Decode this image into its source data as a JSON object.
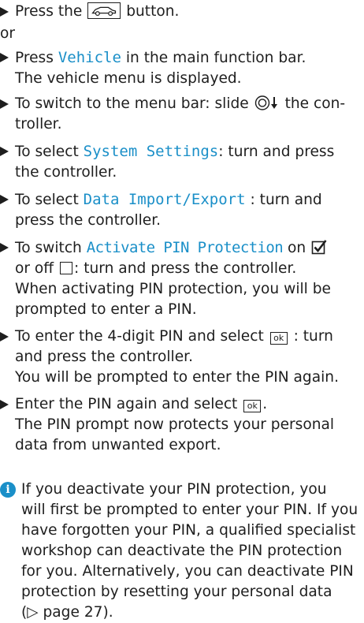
{
  "steps": [
    {
      "pre": "Press the",
      "post": "button."
    },
    {
      "or": "or"
    },
    {
      "pre": "Press",
      "kw": "Vehicle",
      "post": "in the main function bar.",
      "result": "The vehicle menu is displayed."
    },
    {
      "pre": "To switch to the menu bar: slide",
      "post_a": "the con-",
      "post_b": "troller."
    },
    {
      "pre": "To select",
      "kw": "System Settings",
      "post_a": ": turn and press",
      "post_b": "the controller."
    },
    {
      "pre": "To select",
      "kw": "Data Import/Export",
      "post_a": ": turn and",
      "post_b": "press the controller."
    },
    {
      "pre": "To switch",
      "kw": "Activate PIN Protection",
      "on": "on",
      "or_off": "or off",
      "tail": ": turn and press the controller.",
      "result_a": "When activating PIN protection, you will be",
      "result_b": "prompted to enter a PIN."
    },
    {
      "pre": "To enter the 4-digit PIN and select",
      "ok": "ok",
      "post_a": ": turn",
      "post_b": "and press the controller.",
      "result": "You will be prompted to enter the PIN again."
    },
    {
      "pre": "Enter the PIN again and select",
      "ok": "ok",
      "post": ".",
      "result_a": "The PIN prompt now protects your personal",
      "result_b": "data from unwanted export."
    }
  ],
  "note": {
    "icon": "info-icon",
    "lines": [
      "If you deactivate your PIN protection, you",
      "will first be prompted to enter your PIN. If you",
      "have forgotten your PIN, a qualified specialist",
      "workshop can deactivate the PIN protection",
      "for you. Alternatively, you can deactivate PIN",
      "protection by resetting your personal data",
      "(▷ page 27)."
    ]
  },
  "colors": {
    "keyword": "#1a8fc8",
    "text": "#1e1e1e"
  }
}
